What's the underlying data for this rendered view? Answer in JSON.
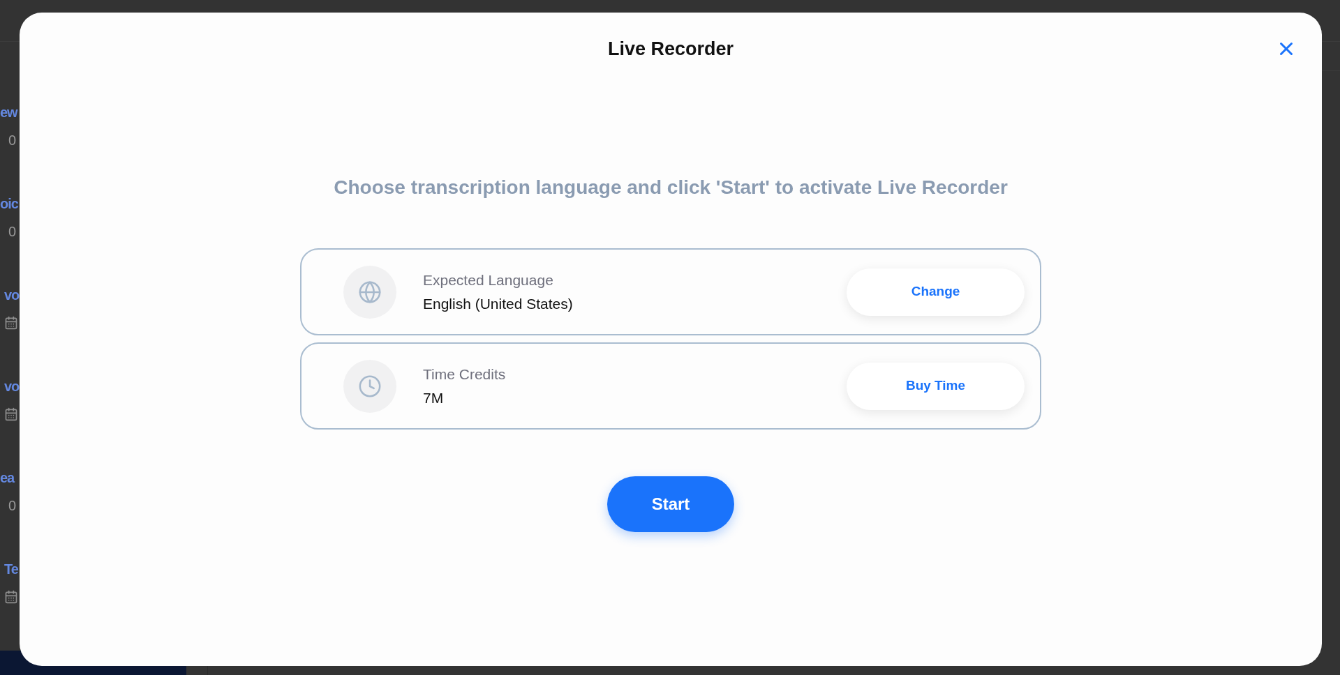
{
  "background": {
    "sidebar": [
      {
        "kind": "count",
        "title": "ew",
        "detail": "0"
      },
      {
        "kind": "count",
        "title": "oic",
        "detail": "0"
      },
      {
        "kind": "date",
        "title": "vo"
      },
      {
        "kind": "date",
        "title": "vo"
      },
      {
        "kind": "count",
        "title": "ea",
        "detail": "0"
      },
      {
        "kind": "date",
        "title": "Te"
      }
    ]
  },
  "dialog": {
    "title": "Live Recorder",
    "instruction": "Choose transcription language and click 'Start' to activate Live Recorder",
    "settings": [
      {
        "kind": "language",
        "label": "Expected Language",
        "value": "English (United States)",
        "action": "Change"
      },
      {
        "kind": "time",
        "label": "Time Credits",
        "value": "7M",
        "action": "Buy Time"
      }
    ],
    "primary_button": "Start"
  }
}
